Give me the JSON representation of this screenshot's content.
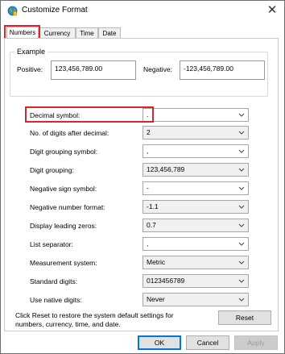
{
  "window": {
    "title": "Customize Format",
    "close_glyph": "✕"
  },
  "tabs": [
    {
      "label": "Numbers",
      "active": true
    },
    {
      "label": "Currency",
      "active": false
    },
    {
      "label": "Time",
      "active": false
    },
    {
      "label": "Date",
      "active": false
    }
  ],
  "example": {
    "group_label": "Example",
    "positive_label": "Positive:",
    "positive_value": "123,456,789.00",
    "negative_label": "Negative:",
    "negative_value": "-123,456,789.00"
  },
  "settings": [
    {
      "label": "Decimal symbol:",
      "value": ".",
      "editable": true
    },
    {
      "label": "No. of digits after decimal:",
      "value": "2",
      "editable": false
    },
    {
      "label": "Digit grouping symbol:",
      "value": ",",
      "editable": true
    },
    {
      "label": "Digit grouping:",
      "value": "123,456,789",
      "editable": false
    },
    {
      "label": "Negative sign symbol:",
      "value": "-",
      "editable": true
    },
    {
      "label": "Negative number format:",
      "value": "-1.1",
      "editable": false
    },
    {
      "label": "Display leading zeros:",
      "value": "0.7",
      "editable": false
    },
    {
      "label": "List separator:",
      "value": ",",
      "editable": true
    },
    {
      "label": "Measurement system:",
      "value": "Metric",
      "editable": false
    },
    {
      "label": "Standard digits:",
      "value": "0123456789",
      "editable": false
    },
    {
      "label": "Use native digits:",
      "value": "Never",
      "editable": false
    }
  ],
  "footer": {
    "reset_text": "Click Reset to restore the system default settings for numbers, currency, time, and date.",
    "reset_button": "Reset",
    "ok_button": "OK",
    "cancel_button": "Cancel",
    "apply_button": "Apply"
  },
  "colors": {
    "highlight": "#d7262e",
    "accent": "#0078d7"
  }
}
